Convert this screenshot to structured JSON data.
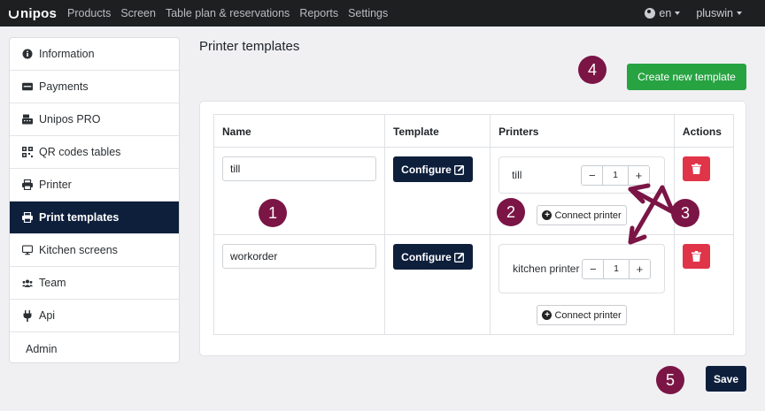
{
  "navbar": {
    "brand": "nipos",
    "links": [
      "Products",
      "Screen",
      "Table plan & reservations",
      "Reports",
      "Settings"
    ],
    "language": "en",
    "user": "pluswin"
  },
  "sidebar": {
    "items": [
      {
        "label": "Information",
        "icon": "info-circle-icon"
      },
      {
        "label": "Payments",
        "icon": "credit-card-icon"
      },
      {
        "label": "Unipos PRO",
        "icon": "cash-register-icon"
      },
      {
        "label": "QR codes tables",
        "icon": "qrcode-icon"
      },
      {
        "label": "Printer",
        "icon": "printer-icon"
      },
      {
        "label": "Print templates",
        "icon": "printer-icon",
        "active": true
      },
      {
        "label": "Kitchen screens",
        "icon": "monitor-icon"
      },
      {
        "label": "Team",
        "icon": "users-icon"
      },
      {
        "label": "Api",
        "icon": "plug-icon"
      },
      {
        "label": "Admin"
      }
    ]
  },
  "main": {
    "title": "Printer templates",
    "create_label": "Create new template",
    "save_label": "Save",
    "table": {
      "headers": [
        "Name",
        "Template",
        "Printers",
        "Actions"
      ],
      "configure_label": "Configure",
      "connect_label": "Connect printer",
      "rows": [
        {
          "name": "till",
          "printer": "till",
          "quantity": "1"
        },
        {
          "name": "workorder",
          "printer": "kitchen printer",
          "quantity": "1"
        }
      ]
    }
  },
  "annotations": {
    "m1": "1",
    "m2": "2",
    "m3": "3",
    "m4": "4",
    "m5": "5",
    "color": "#7b1545"
  },
  "colors": {
    "navbar": "#1d1f21",
    "primary": "#0e1f3c",
    "success": "#27a342",
    "danger": "#e03448"
  }
}
